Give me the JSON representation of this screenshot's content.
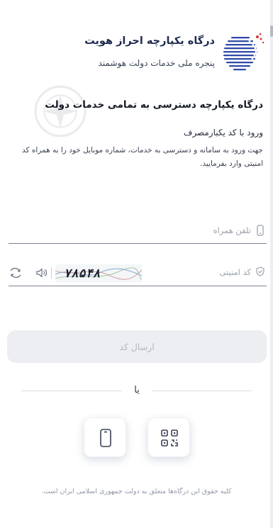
{
  "brand": {
    "title": "درگاه یکپارچه احراز هویت",
    "subtitle": "پنجره ملی خدمات دولت هوشمند"
  },
  "main": {
    "heading": "درگاه یکپارچه دسترسی به تمامی خدمات دولت",
    "subheading": "ورود با کد یکبارمصرف",
    "description": "جهت ورود به سامانه و دسترسی به خدمات، شماره موبایل خود را به همراه کد امنیتی وارد بفرمایید."
  },
  "form": {
    "phone": {
      "placeholder": "تلفن همراه",
      "value": ""
    },
    "captcha": {
      "placeholder": "کد امنیتی",
      "value": "",
      "image_text": "۷۸۵۴۸"
    },
    "submit_label": "ارسال کد"
  },
  "divider_text": "یا",
  "alt_login": {
    "qr_icon": "qr-code-icon",
    "mobile_icon": "mobile-icon"
  },
  "footer": "کلیه حقوق این درگاه‌ها متعلق به دولت جمهوری اسلامی ایران است.",
  "colors": {
    "brand": "#1d2a4d",
    "logo_blue": "#2f4aa8",
    "logo_red": "#d8323a",
    "disabled_button": "#eceef1"
  }
}
